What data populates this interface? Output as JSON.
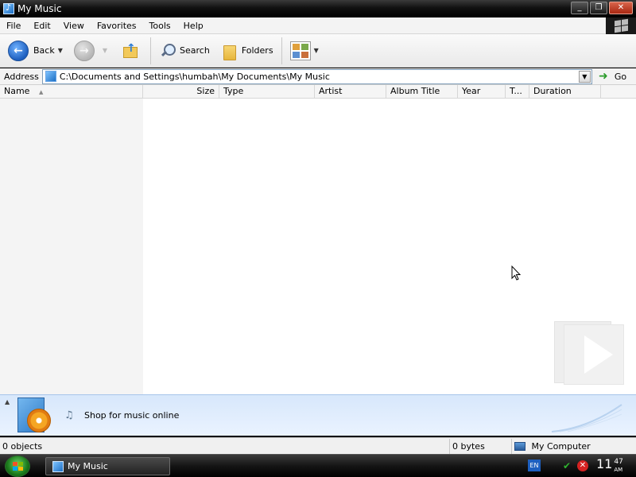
{
  "window": {
    "title": "My Music",
    "buttons": {
      "minimize": "_",
      "maximize": "❐",
      "close": "✕"
    }
  },
  "menu": [
    "File",
    "Edit",
    "View",
    "Favorites",
    "Tools",
    "Help"
  ],
  "toolbar": {
    "back_label": "Back",
    "search_label": "Search",
    "folders_label": "Folders"
  },
  "address": {
    "label": "Address",
    "path": "C:\\Documents and Settings\\humbah\\My Documents\\My Music",
    "go_label": "Go"
  },
  "columns": [
    {
      "label": "Name"
    },
    {
      "label": "Size"
    },
    {
      "label": "Type"
    },
    {
      "label": "Artist"
    },
    {
      "label": "Album Title"
    },
    {
      "label": "Year"
    },
    {
      "label": "T..."
    },
    {
      "label": "Duration"
    }
  ],
  "tasks": {
    "shop_label": "Shop for music online"
  },
  "status": {
    "objects": "0 objects",
    "bytes": "0 bytes",
    "location": "My Computer"
  },
  "taskbar": {
    "window_label": "My Music",
    "language": "EN",
    "clock_hour": "11",
    "clock_minute": "47",
    "clock_ampm": "AM"
  },
  "colors": {
    "titlebar": "#000000",
    "task_strip": "#dbe9fb",
    "start_orb": "#2f9e2f"
  }
}
